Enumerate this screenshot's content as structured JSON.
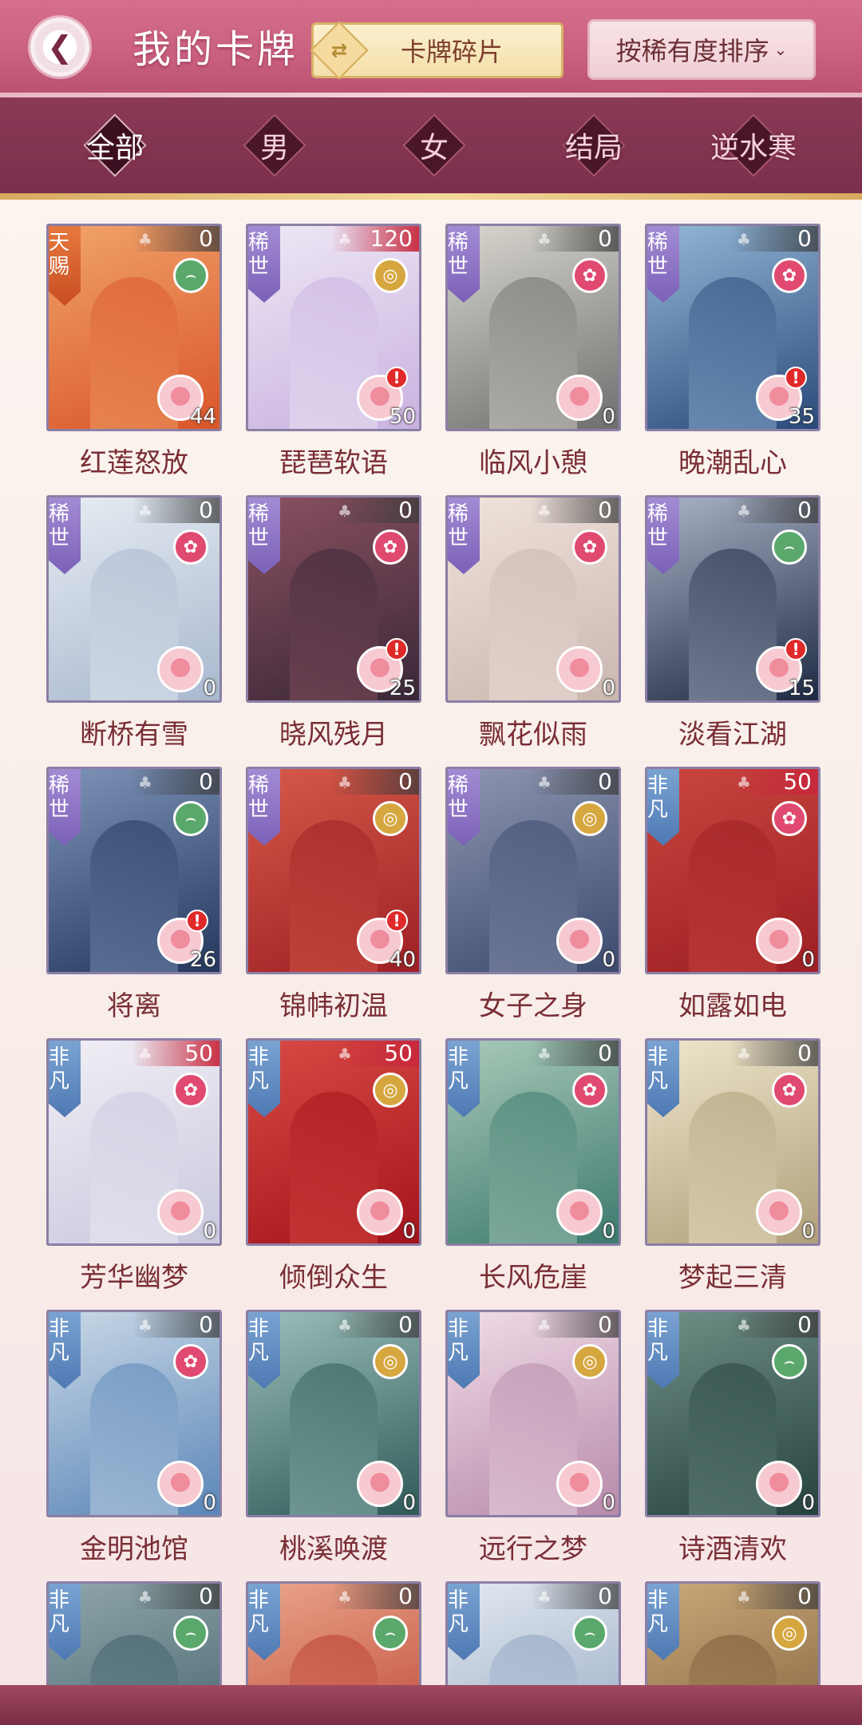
{
  "header": {
    "back_icon": "chevron-left-icon",
    "title": "我的卡牌",
    "switch_label": "卡牌碎片",
    "switch_icon": "swap-icon",
    "sort_label": "按稀有度排序",
    "sort_arrow": "⌄"
  },
  "filters": [
    {
      "label": "全部",
      "active": true
    },
    {
      "label": "男",
      "active": false
    },
    {
      "label": "女",
      "active": false
    },
    {
      "label": "结局",
      "active": false
    },
    {
      "label": "逆水寒",
      "active": false
    }
  ],
  "cards": [
    {
      "name": "红莲怒放",
      "tag": "天赐",
      "tag_type": "tianci",
      "count": "0",
      "attr": "fan",
      "num": "44",
      "alert": false,
      "highlight": false,
      "palette": [
        "#d9552a",
        "#f0a36a"
      ]
    },
    {
      "name": "琵琶软语",
      "tag": "稀世",
      "tag_type": "xishi",
      "count": "120",
      "attr": "coin",
      "num": "50",
      "alert": true,
      "highlight": true,
      "palette": [
        "#c9b2e0",
        "#eee8f5"
      ]
    },
    {
      "name": "临风小憩",
      "tag": "稀世",
      "tag_type": "xishi",
      "count": "0",
      "attr": "flower",
      "num": "0",
      "alert": false,
      "highlight": false,
      "palette": [
        "#6e6f6e",
        "#d9d6cf"
      ]
    },
    {
      "name": "晚潮乱心",
      "tag": "稀世",
      "tag_type": "xishi",
      "count": "0",
      "attr": "flower",
      "num": "35",
      "alert": true,
      "highlight": false,
      "palette": [
        "#2a4a7a",
        "#93b7d6"
      ]
    },
    {
      "name": "断桥有雪",
      "tag": "稀世",
      "tag_type": "xishi",
      "count": "0",
      "attr": "flower",
      "num": "0",
      "alert": false,
      "highlight": false,
      "palette": [
        "#a9b8cf",
        "#e6ecf2"
      ]
    },
    {
      "name": "晓风残月",
      "tag": "稀世",
      "tag_type": "xishi",
      "count": "0",
      "attr": "flower",
      "num": "25",
      "alert": true,
      "highlight": false,
      "palette": [
        "#3a2838",
        "#8a5060"
      ]
    },
    {
      "name": "飘花似雨",
      "tag": "稀世",
      "tag_type": "xishi",
      "count": "0",
      "attr": "flower",
      "num": "0",
      "alert": false,
      "highlight": false,
      "palette": [
        "#c9b7b0",
        "#f0e3dc"
      ]
    },
    {
      "name": "淡看江湖",
      "tag": "稀世",
      "tag_type": "xishi",
      "count": "0",
      "attr": "fan",
      "num": "15",
      "alert": true,
      "highlight": false,
      "palette": [
        "#1e2a44",
        "#aab3c6"
      ]
    },
    {
      "name": "将离",
      "tag": "稀世",
      "tag_type": "xishi",
      "count": "0",
      "attr": "fan",
      "num": "26",
      "alert": true,
      "highlight": false,
      "palette": [
        "#24385e",
        "#7e93b8"
      ]
    },
    {
      "name": "锦帏初温",
      "tag": "稀世",
      "tag_type": "xishi",
      "count": "0",
      "attr": "coin",
      "num": "40",
      "alert": true,
      "highlight": false,
      "palette": [
        "#9e1f24",
        "#d65a49"
      ]
    },
    {
      "name": "女子之身",
      "tag": "稀世",
      "tag_type": "xishi",
      "count": "0",
      "attr": "coin",
      "num": "0",
      "alert": false,
      "highlight": false,
      "palette": [
        "#3c4a6e",
        "#8e96b0"
      ]
    },
    {
      "name": "如露如电",
      "tag": "非凡",
      "tag_type": "feifan",
      "count": "50",
      "attr": "flower",
      "num": "0",
      "alert": false,
      "highlight": true,
      "palette": [
        "#9e1f24",
        "#c9463e"
      ]
    },
    {
      "name": "芳华幽梦",
      "tag": "非凡",
      "tag_type": "feifan",
      "count": "50",
      "attr": "flower",
      "num": "0",
      "alert": false,
      "highlight": true,
      "palette": [
        "#c9c9df",
        "#f1eef4"
      ]
    },
    {
      "name": "倾倒众生",
      "tag": "非凡",
      "tag_type": "feifan",
      "count": "50",
      "attr": "coin",
      "num": "0",
      "alert": false,
      "highlight": true,
      "palette": [
        "#a4141c",
        "#d84a44"
      ]
    },
    {
      "name": "长风危崖",
      "tag": "非凡",
      "tag_type": "feifan",
      "count": "0",
      "attr": "flower",
      "num": "0",
      "alert": false,
      "highlight": false,
      "palette": [
        "#3d7a6e",
        "#a9c9b9"
      ]
    },
    {
      "name": "梦起三清",
      "tag": "非凡",
      "tag_type": "feifan",
      "count": "0",
      "attr": "flower",
      "num": "0",
      "alert": false,
      "highlight": false,
      "palette": [
        "#b0a07a",
        "#eee5cc"
      ]
    },
    {
      "name": "金明池馆",
      "tag": "非凡",
      "tag_type": "feifan",
      "count": "0",
      "attr": "flower",
      "num": "0",
      "alert": false,
      "highlight": false,
      "palette": [
        "#5a86b8",
        "#c9d8e6"
      ]
    },
    {
      "name": "桃溪唤渡",
      "tag": "非凡",
      "tag_type": "feifan",
      "count": "0",
      "attr": "coin",
      "num": "0",
      "alert": false,
      "highlight": false,
      "palette": [
        "#2f5a58",
        "#9bbfba"
      ]
    },
    {
      "name": "远行之梦",
      "tag": "非凡",
      "tag_type": "feifan",
      "count": "0",
      "attr": "coin",
      "num": "0",
      "alert": false,
      "highlight": false,
      "palette": [
        "#b78aaa",
        "#f0dce6"
      ]
    },
    {
      "name": "诗酒清欢",
      "tag": "非凡",
      "tag_type": "feifan",
      "count": "0",
      "attr": "fan",
      "num": "0",
      "alert": false,
      "highlight": false,
      "palette": [
        "#26423e",
        "#6f8f86"
      ]
    },
    {
      "name": "",
      "tag": "非凡",
      "tag_type": "feifan",
      "count": "0",
      "attr": "fan",
      "num": "",
      "alert": false,
      "highlight": false,
      "palette": [
        "#3e5d66",
        "#8fa6ab"
      ]
    },
    {
      "name": "",
      "tag": "非凡",
      "tag_type": "feifan",
      "count": "0",
      "attr": "fan",
      "num": "",
      "alert": false,
      "highlight": false,
      "palette": [
        "#b83c2e",
        "#eaa58a"
      ]
    },
    {
      "name": "",
      "tag": "非凡",
      "tag_type": "feifan",
      "count": "0",
      "attr": "fan",
      "num": "",
      "alert": false,
      "highlight": false,
      "palette": [
        "#8fa3c0",
        "#e2e8f0"
      ]
    },
    {
      "name": "",
      "tag": "非凡",
      "tag_type": "feifan",
      "count": "0",
      "attr": "coin",
      "num": "",
      "alert": false,
      "highlight": false,
      "palette": [
        "#7a5a38",
        "#c9a878"
      ]
    }
  ]
}
